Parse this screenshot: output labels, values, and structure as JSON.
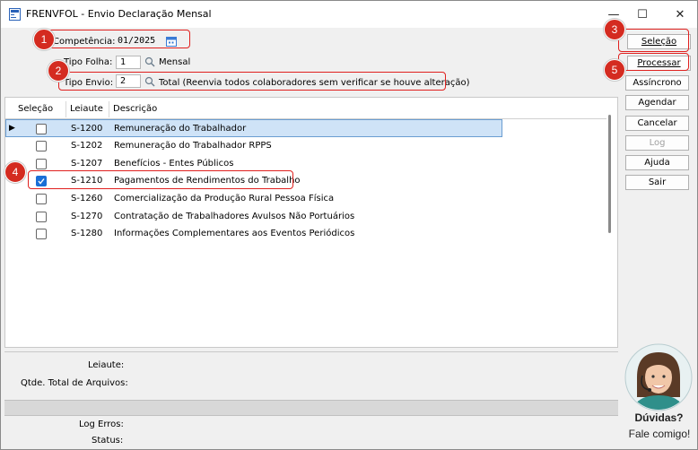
{
  "window": {
    "title": "FRENVFOL - Envio Declaração Mensal",
    "minimize": "—",
    "maximize": "☐",
    "close": "✕"
  },
  "form": {
    "competencia_label": "Competência:",
    "competencia_value": "01/2025",
    "tipo_folha_label": "Tipo Folha:",
    "tipo_folha_value": "1",
    "tipo_folha_desc": "Mensal",
    "tipo_envio_label": "Tipo Envio:",
    "tipo_envio_value": "2",
    "tipo_envio_desc": "Total (Reenvia todos colaboradores sem verificar se houve alteração)"
  },
  "grid": {
    "columns": [
      "Seleção",
      "Leiaute",
      "Descrição"
    ],
    "rows": [
      {
        "checked": false,
        "leiaute": "S-1200",
        "descricao": "Remuneração do Trabalhador"
      },
      {
        "checked": false,
        "leiaute": "S-1202",
        "descricao": "Remuneração do Trabalhador RPPS"
      },
      {
        "checked": false,
        "leiaute": "S-1207",
        "descricao": "Benefícios - Entes Públicos"
      },
      {
        "checked": true,
        "leiaute": "S-1210",
        "descricao": "Pagamentos de Rendimentos do Trabalho"
      },
      {
        "checked": false,
        "leiaute": "S-1260",
        "descricao": "Comercialização da Produção Rural Pessoa Física"
      },
      {
        "checked": false,
        "leiaute": "S-1270",
        "descricao": "Contratação de Trabalhadores Avulsos Não Portuários"
      },
      {
        "checked": false,
        "leiaute": "S-1280",
        "descricao": "Informações Complementares aos Eventos Periódicos"
      }
    ]
  },
  "buttons": {
    "selecao": "Seleção",
    "processar": "Processar",
    "assincrono": "Assíncrono",
    "agendar": "Agendar",
    "cancelar": "Cancelar",
    "log": "Log",
    "ajuda": "Ajuda",
    "sair": "Sair"
  },
  "bottom": {
    "leiaute_label": "Leiaute:",
    "qtde_label": "Qtde. Total de Arquivos:",
    "log_erros_label": "Log Erros:",
    "status_label": "Status:"
  },
  "help": {
    "line1": "Dúvidas?",
    "line2": "Fale comigo!"
  },
  "badges": [
    "1",
    "2",
    "3",
    "4",
    "5"
  ],
  "colors": {
    "highlight_red": "#e0201e",
    "badge_red": "#d42b20",
    "selected_row": "#cfe3f7",
    "checkbox_on": "#1a6fd6"
  }
}
